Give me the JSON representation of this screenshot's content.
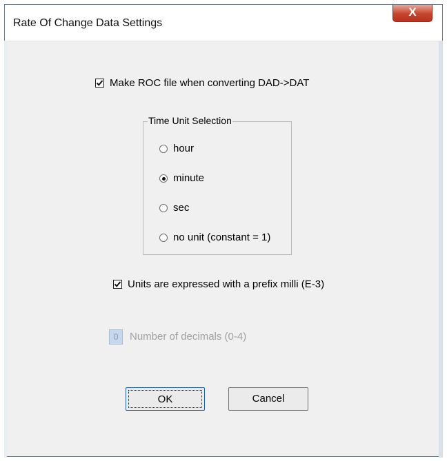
{
  "dialog": {
    "title": "Rate Of Change Data Settings",
    "close_label": "X"
  },
  "make_roc": {
    "label": "Make ROC file when converting DAD->DAT",
    "checked": true
  },
  "time_unit": {
    "group_label": "Time Unit Selection",
    "options": [
      {
        "label": "hour",
        "selected": false
      },
      {
        "label": "minute",
        "selected": true
      },
      {
        "label": "sec",
        "selected": false
      },
      {
        "label": "no unit (constant = 1)",
        "selected": false
      }
    ]
  },
  "milli_prefix": {
    "label": "Units are expressed with a prefix milli (E-3)",
    "checked": true
  },
  "decimals": {
    "value": "0",
    "label": "Number of decimals (0-4)",
    "enabled": false
  },
  "buttons": {
    "ok": "OK",
    "cancel": "Cancel"
  }
}
